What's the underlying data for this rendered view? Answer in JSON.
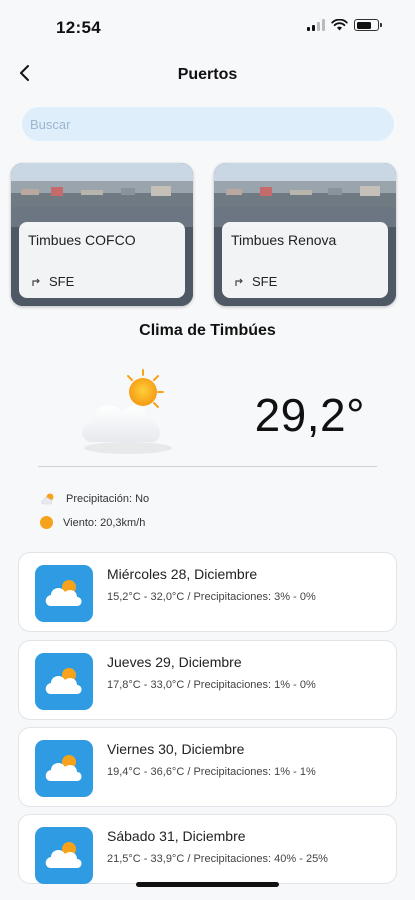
{
  "status": {
    "time": "12:54"
  },
  "nav": {
    "title": "Puertos",
    "back_icon": "chevron-left-icon"
  },
  "search": {
    "placeholder": "Buscar",
    "value": ""
  },
  "ports": [
    {
      "name": "Timbues COFCO",
      "code": "SFE",
      "icon": "arrow-turn-icon"
    },
    {
      "name": "Timbues Renova",
      "code": "SFE",
      "icon": "arrow-turn-icon"
    }
  ],
  "current_weather": {
    "city_title": "Clima de Timbúes",
    "temperature": "29,2°",
    "icon": "sun-behind-cloud-icon",
    "precipitation": "Precipitación: No",
    "wind": "Viento: 20,3km/h"
  },
  "forecast": [
    {
      "day": "Miércoles 28, Diciembre",
      "details": "15,2°C - 32,0°C  / Precipitaciones: 3% - 0%"
    },
    {
      "day": "Jueves 29, Diciembre",
      "details": "17,8°C - 33,0°C  / Precipitaciones: 1% - 0%"
    },
    {
      "day": "Viernes 30, Diciembre",
      "details": "19,4°C - 36,6°C  / Precipitaciones: 1% - 1%"
    },
    {
      "day": "Sábado 31, Diciembre",
      "details": "21,5°C - 33,9°C  / Precipitaciones: 40% - 25%"
    }
  ],
  "colors": {
    "accent": "#2f9be3",
    "sun": "#f7a21b",
    "search_bg": "#dfeefb"
  }
}
